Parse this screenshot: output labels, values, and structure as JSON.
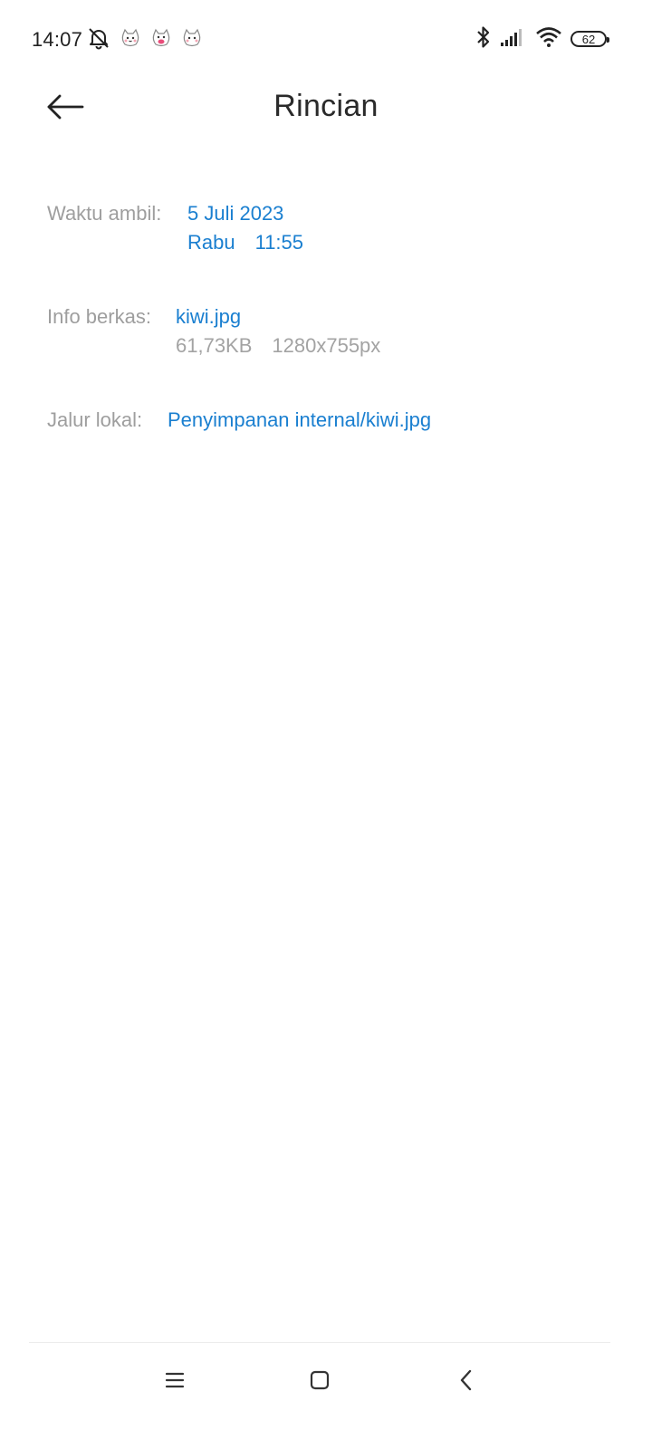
{
  "status_bar": {
    "time": "14:07",
    "battery_level": "62",
    "icons": [
      "bell-off-icon",
      "cat-sticker-icon",
      "cat-sticker-icon",
      "cat-sticker-icon",
      "bluetooth-icon",
      "signal-icon",
      "wifi-icon",
      "battery-icon"
    ]
  },
  "header": {
    "title": "Rincian",
    "back_icon": "arrow-left-icon"
  },
  "details": {
    "taken_time": {
      "label": "Waktu ambil:",
      "date": "5 Juli 2023",
      "day": "Rabu",
      "time": "11:55"
    },
    "file_info": {
      "label": "Info berkas:",
      "name": "kiwi.jpg",
      "size": "61,73KB",
      "resolution": "1280x755px"
    },
    "local_path": {
      "label": "Jalur lokal:",
      "path": "Penyimpanan internal/kiwi.jpg"
    }
  },
  "nav_bar": {
    "icons": [
      "menu-icon",
      "home-icon",
      "back-icon"
    ]
  },
  "colors": {
    "accent": "#1a7fd0",
    "label": "#9e9e9e",
    "secondary": "#a3a3a3",
    "title": "#2a2a2a"
  }
}
